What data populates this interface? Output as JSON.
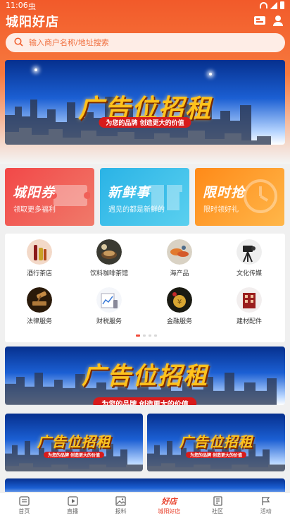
{
  "status_bar": {
    "time": "11:06",
    "carrier": "虫"
  },
  "header": {
    "title": "城阳好店"
  },
  "search": {
    "placeholder": "输入商户名称/地址搜索"
  },
  "banner": {
    "title": "广告位招租",
    "subtitle": "为您的品牌 创造更大的价值"
  },
  "promos": [
    {
      "title": "城阳券",
      "subtitle": "领取更多福利",
      "color": "#f24848"
    },
    {
      "title": "新鲜事",
      "subtitle": "遇见的都是新鲜的",
      "color": "#2ab3e6"
    },
    {
      "title": "限时抢",
      "subtitle": "限时领好礼",
      "color": "#ff8a18"
    }
  ],
  "categories": [
    {
      "label": "酒行茶店",
      "icon": "liquor-icon"
    },
    {
      "label": "饮料咖啡茶馆",
      "icon": "coffee-icon"
    },
    {
      "label": "海产品",
      "icon": "seafood-icon"
    },
    {
      "label": "文化传媒",
      "icon": "camera-icon"
    },
    {
      "label": "法律服务",
      "icon": "law-icon"
    },
    {
      "label": "财税服务",
      "icon": "finance-icon"
    },
    {
      "label": "金融服务",
      "icon": "bank-icon"
    },
    {
      "label": "建材配件",
      "icon": "building-materials-icon"
    }
  ],
  "nav": [
    {
      "label": "首页",
      "icon": "home-icon"
    },
    {
      "label": "直播",
      "icon": "live-icon"
    },
    {
      "label": "报料",
      "icon": "image-icon"
    },
    {
      "label": "城阳好店",
      "icon": "store-logo-icon",
      "logo": "好店",
      "active": true
    },
    {
      "label": "社区",
      "icon": "community-icon"
    },
    {
      "label": "活动",
      "icon": "flag-icon"
    }
  ],
  "colors": {
    "primary": "#f25a2a",
    "accent": "#e8412c",
    "banner_text": "#ffc21c"
  }
}
